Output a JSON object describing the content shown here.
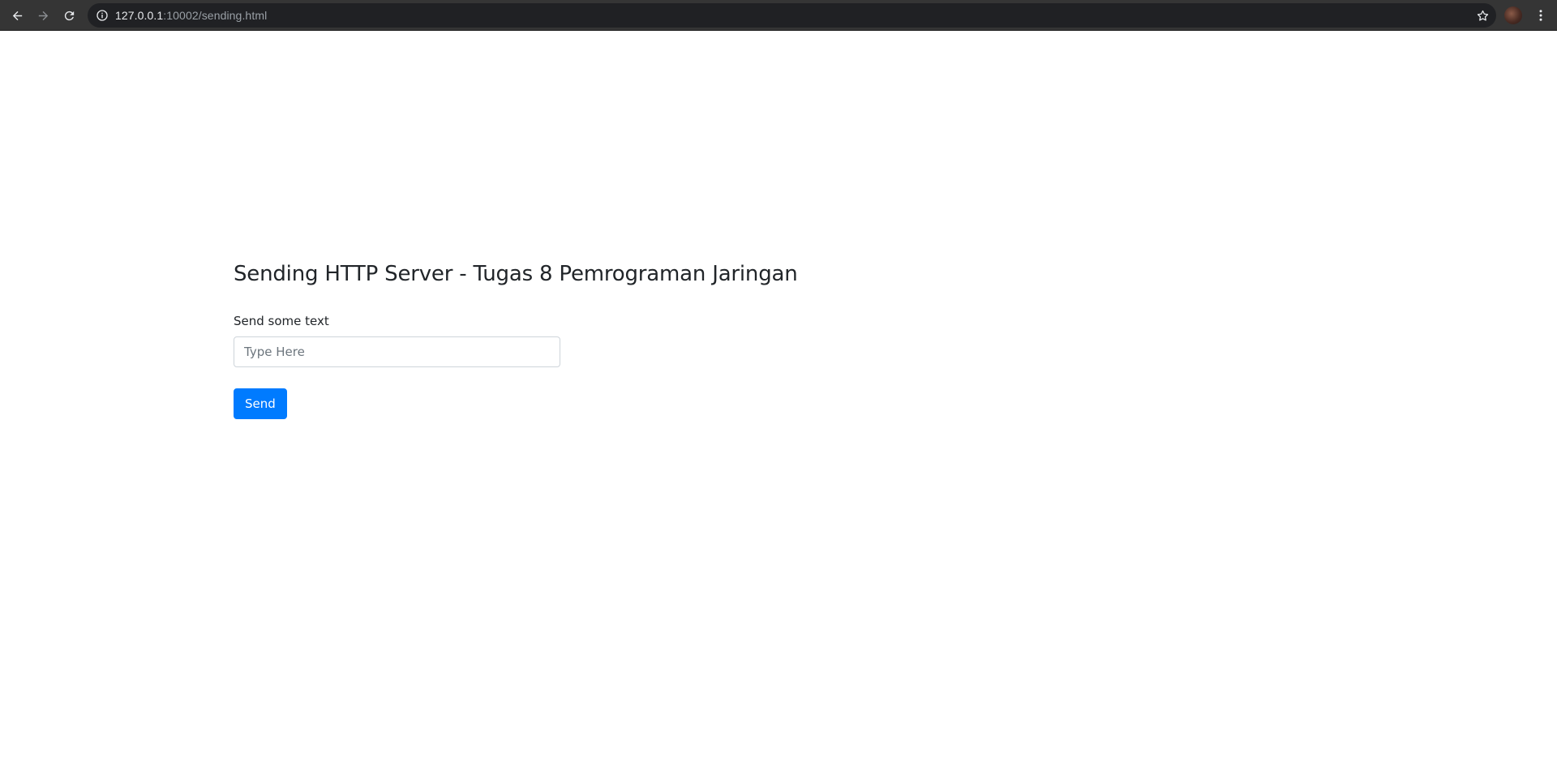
{
  "browser": {
    "url_host": "127.0.0.1",
    "url_rest": ":10002/sending.html",
    "icons": {
      "back": "arrow-left-icon",
      "forward": "arrow-right-icon",
      "reload": "reload-icon",
      "info": "info-icon",
      "bookmark": "star-icon",
      "menu": "kebab-menu-icon"
    }
  },
  "page": {
    "title": "Sending HTTP Server - Tugas 8 Pemrograman Jaringan",
    "form": {
      "label": "Send some text",
      "input_value": "",
      "input_placeholder": "Type Here",
      "submit_label": "Send"
    }
  },
  "colors": {
    "toolbar_bg": "#353535",
    "omnibox_bg": "#202124",
    "primary_button": "#007bff",
    "text": "#212529"
  }
}
